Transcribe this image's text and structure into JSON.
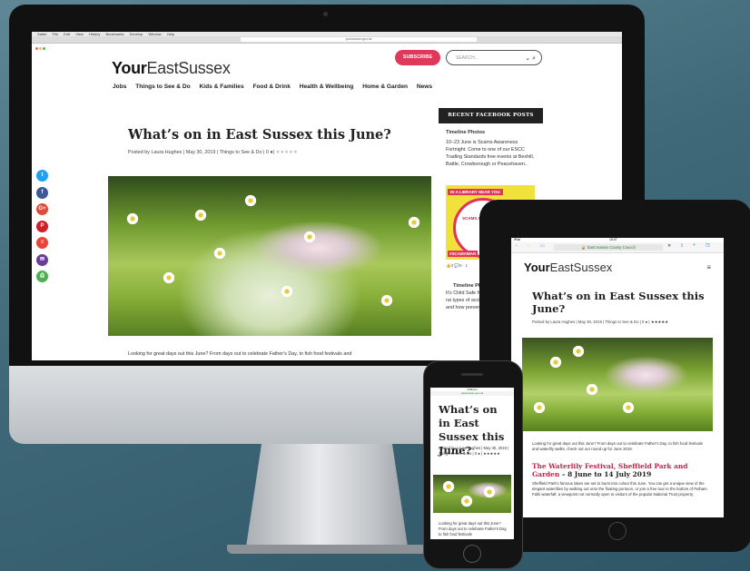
{
  "mac": {
    "menu": [
      "Safari",
      "File",
      "Edit",
      "View",
      "History",
      "Bookmarks",
      "Develop",
      "Window",
      "Help"
    ],
    "url": "yoursussex.gov.uk"
  },
  "site": {
    "logo_bold": "Your",
    "logo_rest": "EastSussex",
    "subscribe": "SUBSCRIBE",
    "search_placeholder": "SEARCH...",
    "nav": [
      "Jobs",
      "Things to See & Do",
      "Kids & Families",
      "Food & Drink",
      "Health & Wellbeing",
      "Home & Garden",
      "News"
    ]
  },
  "article": {
    "title": "What’s on in East Sussex this June?",
    "byline": "Posted by Laura Hughes | May 30, 2019 | Things to See & Do | 0 ●|",
    "stars": "★★★★★",
    "lead": "Looking for great days out this June? From days out to celebrate Father's Day, to fish food festivals and"
  },
  "social": [
    {
      "name": "twitter-icon",
      "glyph": "t",
      "color": "#1da1f2"
    },
    {
      "name": "facebook-icon",
      "glyph": "f",
      "color": "#3b5998"
    },
    {
      "name": "google-plus-icon",
      "glyph": "G+",
      "color": "#dd4b39"
    },
    {
      "name": "pinterest-icon",
      "glyph": "P",
      "color": "#cb2027"
    },
    {
      "name": "mix-icon",
      "glyph": "≡",
      "color": "#e8443a"
    },
    {
      "name": "email-icon",
      "glyph": "✉",
      "color": "#6a3d9a"
    },
    {
      "name": "print-icon",
      "glyph": "⎙",
      "color": "#4caf50"
    }
  ],
  "sidebar": {
    "heading": "RECENT FACEBOOK POSTS",
    "post1_label": "Timeline Photos",
    "post1_text": "10–23 June is Scams Awareness Fortnight. Come to one of our ESCC Trading Standards free events at Bexhill, Battle, Crowborough or Peacehaven..",
    "img_banner": "IN A LIBRARY NEAR YOU",
    "img_text": "SCAMS AWARE",
    "img_tag": "#SCAMAWAR",
    "reactions": "👍3 💬0 · 1",
    "post2_label": "Timeline Phot",
    "post2_text": "It's Child Safe helping to rai types of accid have and how prevented. Vi"
  },
  "ipad": {
    "status_left": "iPad",
    "status_time": "15:07",
    "url": "East Sussex County Council",
    "title": "What’s on in East Sussex this June?",
    "byline": "Posted by Laura Hughes | May 30, 2019 | Things to See & Do | 0 ● | ★★★★★",
    "lead": "Looking for great days out this June? From days out to celebrate Father's Day, to fish food festivals and waterlily walks, check out our round up for June 2019.",
    "h2": "The Waterlily Festival, Sheffield Park and Garden",
    "h2_suffix": " – 8 June to 14 July 2019",
    "body": "Sheffield Park's famous lakes are set to burst into colour this June. You can get a unique view of the elegant waterlilies by walking out onto the floating pontoon, or join a free tour to the bottom of Pulham Falls waterfall; a viewpoint not normally open to visitors of the popular National Trust property."
  },
  "iphone": {
    "status": "3:59 pm",
    "url": "eastsussex.gov.uk",
    "title": "What’s on in East Sussex this June?",
    "byline": "Posted by Laura Hughes | May 30, 2019 | Things to See & Do | 0 ● | ★★★★★",
    "lead": "Looking for great days out this June? From days out to celebrate Father's Day, to fish food festivals"
  }
}
